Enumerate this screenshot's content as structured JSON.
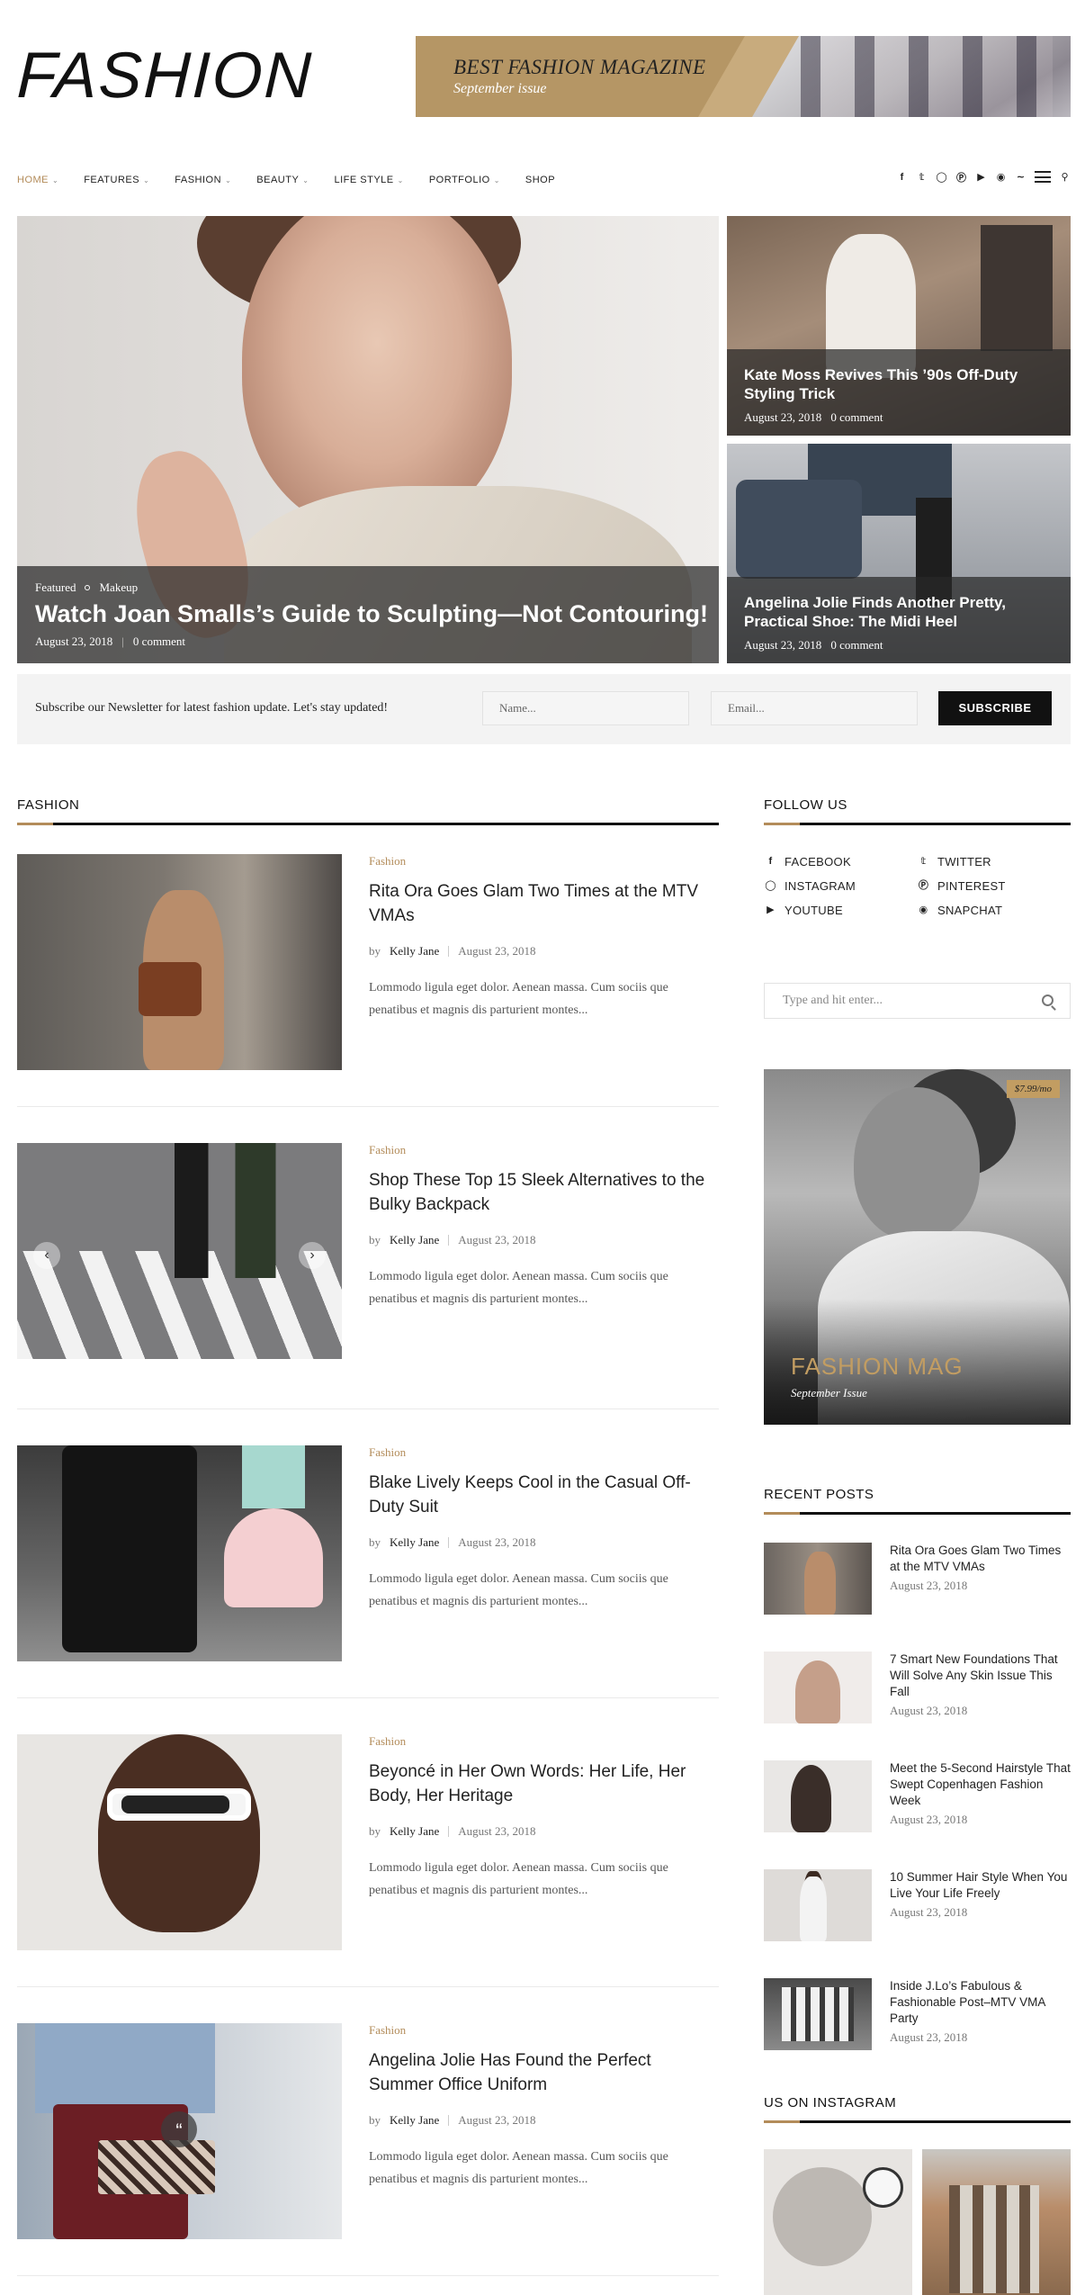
{
  "header": {
    "logo": "FASHION",
    "banner": {
      "title": "BEST FASHION MAGAZINE",
      "subtitle": "September issue"
    }
  },
  "nav": {
    "items": [
      {
        "label": "HOME",
        "active": true,
        "has_caret": true
      },
      {
        "label": "FEATURES",
        "has_caret": true
      },
      {
        "label": "FASHION",
        "has_caret": true
      },
      {
        "label": "BEAUTY",
        "has_caret": true
      },
      {
        "label": "LIFE STYLE",
        "has_caret": true
      },
      {
        "label": "PORTFOLIO",
        "has_caret": true
      },
      {
        "label": "SHOP",
        "has_caret": false
      }
    ],
    "social_icons": [
      "facebook-icon",
      "twitter-icon",
      "instagram-icon",
      "pinterest-icon",
      "youtube-icon",
      "snapchat-icon",
      "rss-icon"
    ],
    "accent_color": "#b38c5a"
  },
  "hero": {
    "main": {
      "category": "Featured",
      "subcategory": "Makeup",
      "title": "Watch Joan Smalls’s Guide to Sculpting—Not Contouring!",
      "date": "August 23, 2018",
      "comments": "0 comment"
    },
    "side": [
      {
        "title": "Kate Moss Revives This ’90s Off-Duty Styling Trick",
        "date": "August 23, 2018",
        "comments": "0 comment"
      },
      {
        "title": "Angelina Jolie Finds Another Pretty, Practical Shoe: The Midi Heel",
        "date": "August 23, 2018",
        "comments": "0 comment"
      }
    ]
  },
  "newsletter": {
    "text": "Subscribe our Newsletter for latest fashion update. Let's stay updated!",
    "name_placeholder": "Name...",
    "email_placeholder": "Email...",
    "button": "SUBSCRIBE"
  },
  "fashion_section": {
    "heading": "FASHION",
    "posts": [
      {
        "category": "Fashion",
        "title": "Rita Ora Goes Glam Two Times at the MTV VMAs",
        "by": "by",
        "author": "Kelly Jane",
        "date": "August 23, 2018",
        "excerpt": "Lommodo ligula eget dolor. Aenean massa. Cum sociis que penatibus et magnis dis parturient montes..."
      },
      {
        "category": "Fashion",
        "title": "Shop These Top 15 Sleek Alternatives to the Bulky Backpack",
        "by": "by",
        "author": "Kelly Jane",
        "date": "August 23, 2018",
        "excerpt": "Lommodo ligula eget dolor. Aenean massa. Cum sociis que penatibus et magnis dis parturient montes..."
      },
      {
        "category": "Fashion",
        "title": "Blake Lively Keeps Cool in the Casual Off-Duty Suit",
        "by": "by",
        "author": "Kelly Jane",
        "date": "August 23, 2018",
        "excerpt": "Lommodo ligula eget dolor. Aenean massa. Cum sociis que penatibus et magnis dis parturient montes..."
      },
      {
        "category": "Fashion",
        "title": "Beyoncé in Her Own Words: Her Life, Her Body, Her Heritage",
        "by": "by",
        "author": "Kelly Jane",
        "date": "August 23, 2018",
        "excerpt": "Lommodo ligula eget dolor. Aenean massa. Cum sociis que penatibus et magnis dis parturient montes..."
      },
      {
        "category": "Fashion",
        "title": "Angelina Jolie Has Found the Perfect Summer Office Uniform",
        "by": "by",
        "author": "Kelly Jane",
        "date": "August 23, 2018",
        "excerpt": "Lommodo ligula eget dolor. Aenean massa. Cum sociis que penatibus et magnis dis parturient montes..."
      }
    ]
  },
  "sidebar": {
    "follow_heading": "FOLLOW US",
    "follow": [
      {
        "icon": "facebook-icon",
        "label": "FACEBOOK"
      },
      {
        "icon": "twitter-icon",
        "label": "TWITTER"
      },
      {
        "icon": "instagram-icon",
        "label": "INSTAGRAM"
      },
      {
        "icon": "pinterest-icon",
        "label": "PINTEREST"
      },
      {
        "icon": "youtube-icon",
        "label": "YOUTUBE"
      },
      {
        "icon": "snapchat-icon",
        "label": "SNAPCHAT"
      }
    ],
    "search_placeholder": "Type and hit enter...",
    "ad": {
      "price": "$7.99/mo",
      "title": "FASHION MAG",
      "subtitle": "September Issue"
    },
    "recent_heading": "RECENT POSTS",
    "recent": [
      {
        "title": "Rita Ora Goes Glam Two Times at the MTV VMAs",
        "date": "August 23, 2018"
      },
      {
        "title": "7 Smart New Foundations That Will Solve Any Skin Issue This Fall",
        "date": "August 23, 2018"
      },
      {
        "title": "Meet the 5-Second Hairstyle That Swept Copenhagen Fashion Week",
        "date": "August 23, 2018"
      },
      {
        "title": "10 Summer Hair Style When You Live Your Life Freely",
        "date": "August 23, 2018"
      },
      {
        "title": "Inside J.Lo’s Fabulous & Fashionable Post–MTV VMA Party",
        "date": "August 23, 2018"
      }
    ],
    "instagram_heading": "US ON INSTAGRAM"
  }
}
